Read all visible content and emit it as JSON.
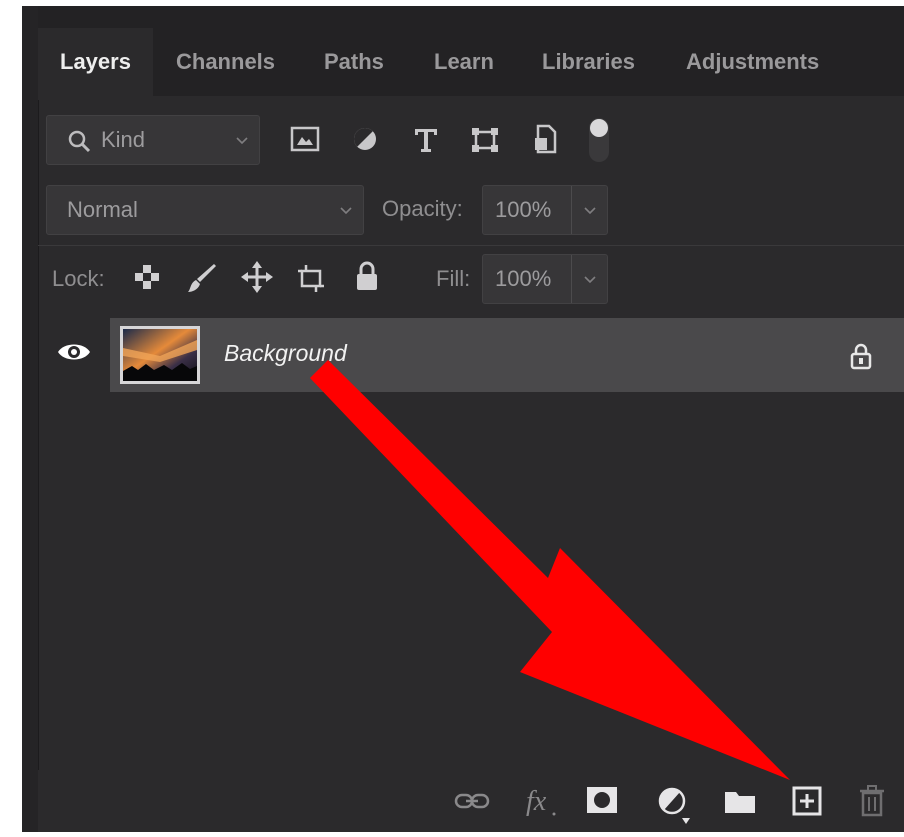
{
  "tabs": [
    "Layers",
    "Channels",
    "Paths",
    "Learn",
    "Libraries",
    "Adjustments"
  ],
  "filter": {
    "kind_label": "Kind",
    "icons": [
      "image-filter-icon",
      "adjustment-filter-icon",
      "type-filter-icon",
      "shape-filter-icon",
      "smart-object-filter-icon",
      "filter-toggle-icon"
    ]
  },
  "blend": {
    "mode": "Normal",
    "opacity_label": "Opacity:",
    "opacity_value": "100%"
  },
  "lock": {
    "label": "Lock:",
    "icons": [
      "lock-transparent-pixels-icon",
      "lock-image-pixels-icon",
      "lock-position-icon",
      "lock-artboard-icon",
      "lock-all-icon"
    ],
    "fill_label": "Fill:",
    "fill_value": "100%"
  },
  "layers": [
    {
      "name": "Background",
      "visible": true,
      "locked": true
    }
  ],
  "bottom_icons": [
    "link-layers-icon",
    "fx-icon",
    "add-mask-icon",
    "adjustment-layer-icon",
    "new-group-icon",
    "new-layer-icon",
    "delete-layer-icon"
  ],
  "colors": {
    "panel": "#2b2a2c",
    "selected_layer": "#4a494b",
    "annotation_arrow": "#ff0000"
  }
}
